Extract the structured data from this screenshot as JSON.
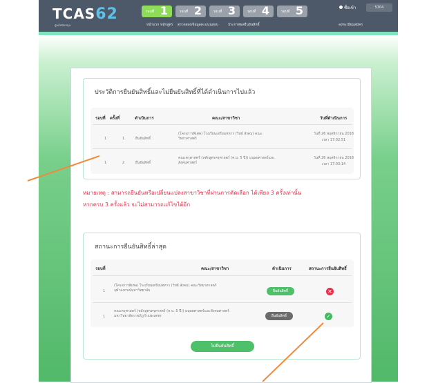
{
  "header": {
    "logo_text": "TCAS",
    "logo_num": "62",
    "logo_sub": "ศูนย์สนับสนุน",
    "rounds": [
      {
        "label": "รอบที่",
        "num": "1",
        "active": true
      },
      {
        "label": "รอบที่",
        "num": "2",
        "active": false
      },
      {
        "label": "รอบที่",
        "num": "3",
        "active": false
      },
      {
        "label": "รอบที่",
        "num": "4",
        "active": false
      },
      {
        "label": "รอบที่",
        "num": "5",
        "active": false
      }
    ],
    "menu": [
      "หน้าแรก",
      "หลักสูตร",
      "ตรวจสอบข้อมูลคะแนนสอบ",
      "ประกาศผลยืนยันสิทธิ์"
    ],
    "login_label": "ชื่อเข้า",
    "user_id": "5304",
    "register_label": "ลงทะเบียนสมัคร"
  },
  "history": {
    "title": "ประวัติการยืนยันสิทธิ์และไม่ยืนยันสิทธิ์ที่ได้ดำเนินการไปแล้ว",
    "headers": [
      "รอบที่",
      "ครั้งที่",
      "ดำเนินการ",
      "คณะ/สาขาวิชา",
      "วันที่ดำเนินการ"
    ],
    "rows": [
      {
        "round": "1",
        "time": "1",
        "action": "ยืนยันสิทธิ์",
        "faculty": "(โครงการพิเศษ) โรงเรียนเตรียมทหาร (วิทย์ สังคม) คณะวิทยาศาสตร์",
        "date": "วันที่ 26 พฤศจิกายน 2018",
        "clock": "เวลา 17:02:51"
      },
      {
        "round": "1",
        "time": "2",
        "action": "ยืนยันสิทธิ์",
        "faculty": "คณะครุศาสตร์ (หลักสูตรครุศาสตร์ (ค.บ. 5 ปี)) มนุษยศาสตร์และสังคมศาสตร์",
        "date": "วันที่ 26 พฤศจิกายน 2018",
        "clock": "เวลา 17:03:14"
      }
    ]
  },
  "warning": {
    "line1": "หมายเหตุ : สามารถยืนยันหรือเปลี่ยนแปลงสาขาวิชาที่ผ่านการคัดเลือก ได้เพียง 3 ครั้งเท่านั้น",
    "line2": "หากครบ 3 ครั้งแล้ว จะไม่สามารถแก้ไขได้อีก"
  },
  "latest": {
    "title": "สถานะการยืนยันสิทธิ์ล่าสุด",
    "headers": [
      "รอบที่",
      "คณะ/สาขาวิชา",
      "ดำเนินการ",
      "สถานะการยืนยันสิทธิ์"
    ],
    "rows": [
      {
        "round": "1",
        "faculty": "(โครงการพิเศษ) โรงเรียนเตรียมทหาร (วิทย์ สังคม) คณะวิทยาศาสตร์ จุฬาลงกรณ์มหาวิทยาลัย",
        "action": "ยืนยันสิทธิ์",
        "status": "rejected"
      },
      {
        "round": "1",
        "faculty": "คณะครุศาสตร์ (หลักสูตรครุศาสตร์ (ค.บ. 5 ปี)) มนุษยศาสตร์และสังคมศาสตร์ มหาวิทยาลัยราชภัฏกำแพงเพชร",
        "action": "ยืนยันสิทธิ์",
        "status": "confirmed"
      }
    ],
    "button_label": "ไม่ยืนยันสิทธิ์"
  },
  "colors": {
    "accent_green": "#4fc06a",
    "header": "#4d5968",
    "warning": "#e8304a",
    "arrow": "#f08a3c"
  }
}
